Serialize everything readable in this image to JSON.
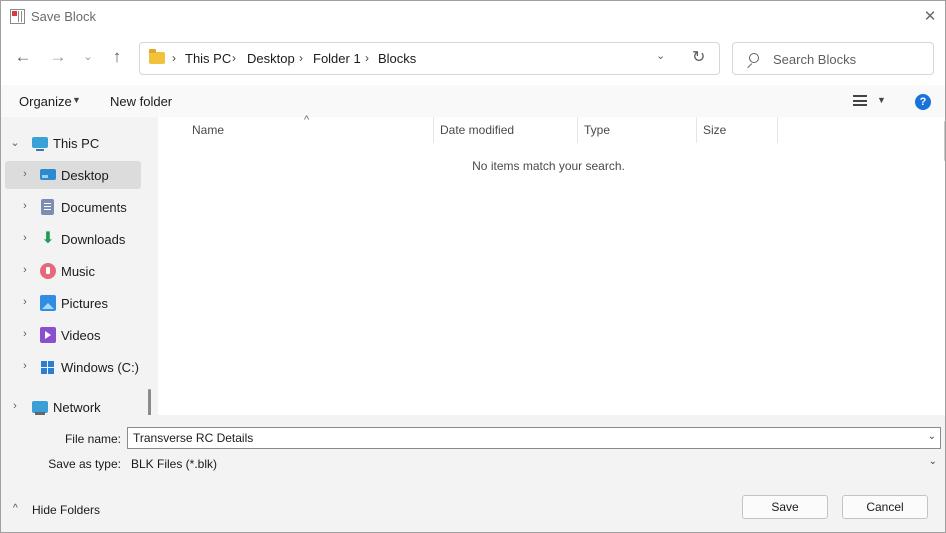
{
  "window": {
    "title": "Save Block",
    "close_glyph": "✕"
  },
  "nav": {
    "back_glyph": "←",
    "forward_glyph": "→",
    "recent_glyph": "⌄",
    "up_glyph": "↑",
    "breadcrumbs": [
      "This PC",
      "Desktop",
      "Folder 1",
      "Blocks"
    ],
    "separator": "›",
    "dropdown_glyph": "⌄",
    "refresh_glyph": "↻",
    "search_placeholder": "Search Blocks"
  },
  "toolbar": {
    "organize": "Organize",
    "organize_caret": "▼",
    "new_folder": "New folder",
    "view_caret": "▼",
    "help": "?"
  },
  "sidebar": {
    "chevron_expanded": "⌄",
    "chevron_collapsed": "›",
    "items": [
      {
        "label": "This PC",
        "icon": "this-pc-icon"
      },
      {
        "label": "Desktop",
        "icon": "desktop-icon"
      },
      {
        "label": "Documents",
        "icon": "documents-icon"
      },
      {
        "label": "Downloads",
        "icon": "downloads-icon"
      },
      {
        "label": "Music",
        "icon": "music-icon"
      },
      {
        "label": "Pictures",
        "icon": "pictures-icon"
      },
      {
        "label": "Videos",
        "icon": "videos-icon"
      },
      {
        "label": "Windows (C:)",
        "icon": "drive-icon"
      },
      {
        "label": "Network",
        "icon": "network-icon"
      }
    ]
  },
  "file_list": {
    "columns": [
      "Name",
      "Date modified",
      "Type",
      "Size"
    ],
    "sort_glyph": "^",
    "empty_message": "No items match your search."
  },
  "form": {
    "file_name_label": "File name:",
    "file_name_value": "Transverse RC Details",
    "save_type_label": "Save as type:",
    "save_type_value": "BLK Files (*.blk)",
    "dropdown_glyph": "⌄"
  },
  "footer": {
    "hide_folders": "Hide Folders",
    "hide_glyph": "^",
    "save_button": "Save",
    "cancel_button": "Cancel"
  },
  "colors": {
    "accent": "#1a73d9",
    "folder": "#f2c23a",
    "selected": "#dcdcdc"
  }
}
